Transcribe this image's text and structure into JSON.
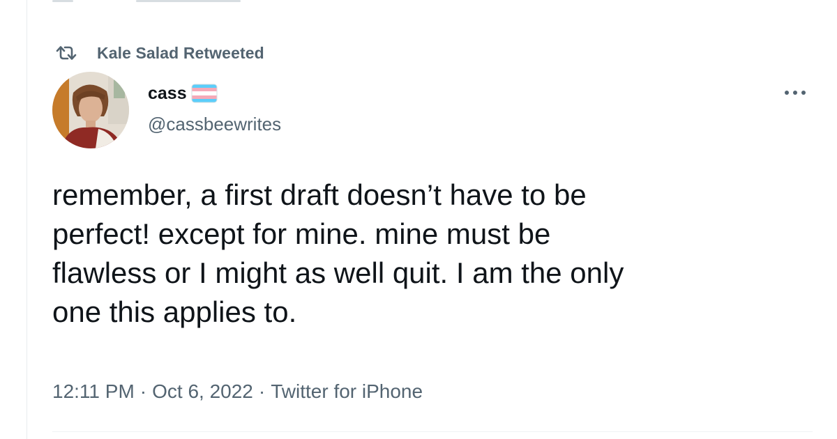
{
  "retweet": {
    "icon": "retweet-icon",
    "label": "Kale Salad Retweeted"
  },
  "author": {
    "display_name": "cass",
    "flag_icon": "transgender-flag-icon",
    "handle": "@cassbeewrites",
    "avatar_icon": "avatar-photo"
  },
  "more_icon": "more-icon",
  "tweet": {
    "text": "remember, a first draft doesn’t have to be\nperfect! except for mine. mine must be\nflawless or I might as well quit. I am the only\none this applies to."
  },
  "meta": {
    "time": "12:11 PM",
    "separator": "·",
    "date": "Oct 6, 2022",
    "source": "Twitter for iPhone"
  },
  "colors": {
    "text_primary": "#0f1419",
    "text_secondary": "#536471",
    "divider": "#eff3f4",
    "flag_blue": "#5bcefa",
    "flag_pink": "#f5a9b8"
  }
}
